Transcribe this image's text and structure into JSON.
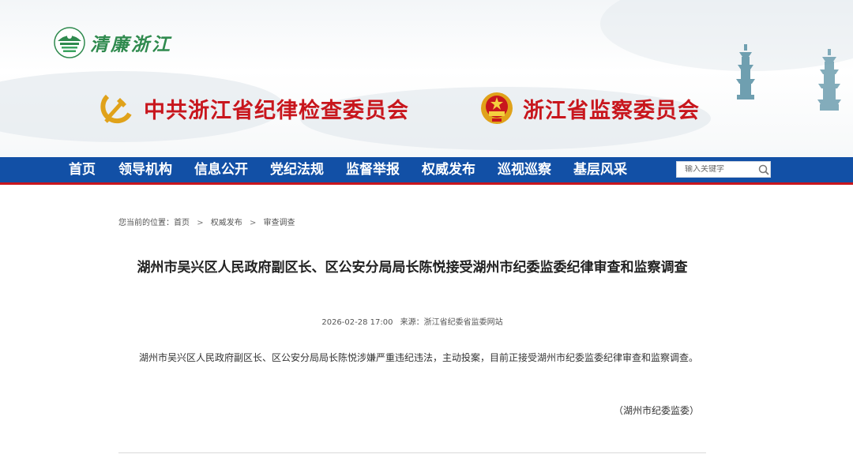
{
  "header": {
    "logo_text": "清廉浙江",
    "org_left": "中共浙江省纪律检查委员会",
    "org_right": "浙江省监察委员会"
  },
  "nav": {
    "items": [
      "首页",
      "领导机构",
      "信息公开",
      "党纪法规",
      "监督举报",
      "权威发布",
      "巡视巡察",
      "基层风采"
    ],
    "search_placeholder": "输入关键字"
  },
  "breadcrumb": {
    "label": "您当前的位置：",
    "items": [
      "首页",
      "权威发布",
      "审查调查"
    ],
    "separator": ">"
  },
  "article": {
    "title": "湖州市吴兴区人民政府副区长、区公安分局局长陈悦接受湖州市纪委监委纪律审查和监察调查",
    "datetime": "2026-02-28 17:00",
    "source": "来源：浙江省纪委省监委网站",
    "body": "湖州市吴兴区人民政府副区长、区公安分局局长陈悦涉嫌严重违纪违法，主动投案，目前正接受湖州市纪委监委纪律审查和监察调查。",
    "signature": "（湖州市纪委监委）"
  },
  "colors": {
    "nav_bg": "#1250a6",
    "accent_red": "#c8161d",
    "logo_green": "#2f8a4e"
  }
}
